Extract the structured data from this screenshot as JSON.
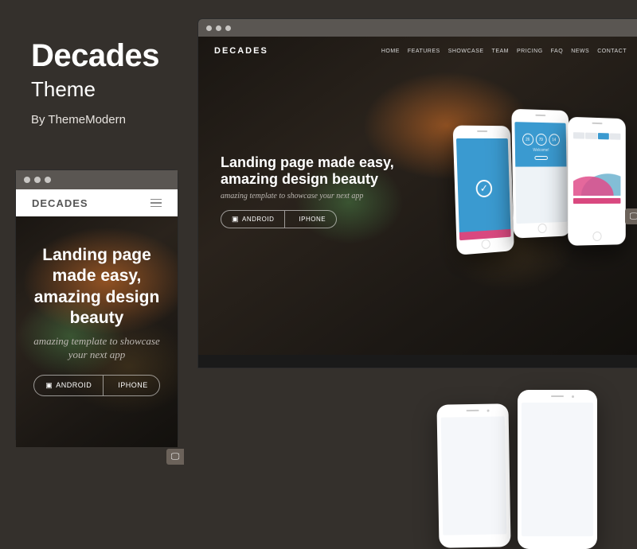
{
  "header": {
    "title": "Decades",
    "subtitle": "Theme",
    "author": "By ThemeModern"
  },
  "site": {
    "logo": "DECADES",
    "nav": [
      "HOME",
      "FEATURES",
      "SHOWCASE",
      "TEAM",
      "PRICING",
      "FAQ",
      "NEWS",
      "CONTACT"
    ]
  },
  "hero": {
    "title_line1": "Landing page made easy,",
    "title_line2": "amazing design beauty",
    "title_mobile": "Landing page made easy, amazing design beauty",
    "tagline": "amazing template to showcase your next app",
    "btn_android": "ANDROID",
    "btn_iphone": "IPHONE"
  },
  "stats": [
    "26",
    "79",
    "14"
  ],
  "icons": {
    "android": "▣",
    "apple": "",
    "check": "✓",
    "monitor": "🖵",
    "hamburger": "menu-icon"
  }
}
